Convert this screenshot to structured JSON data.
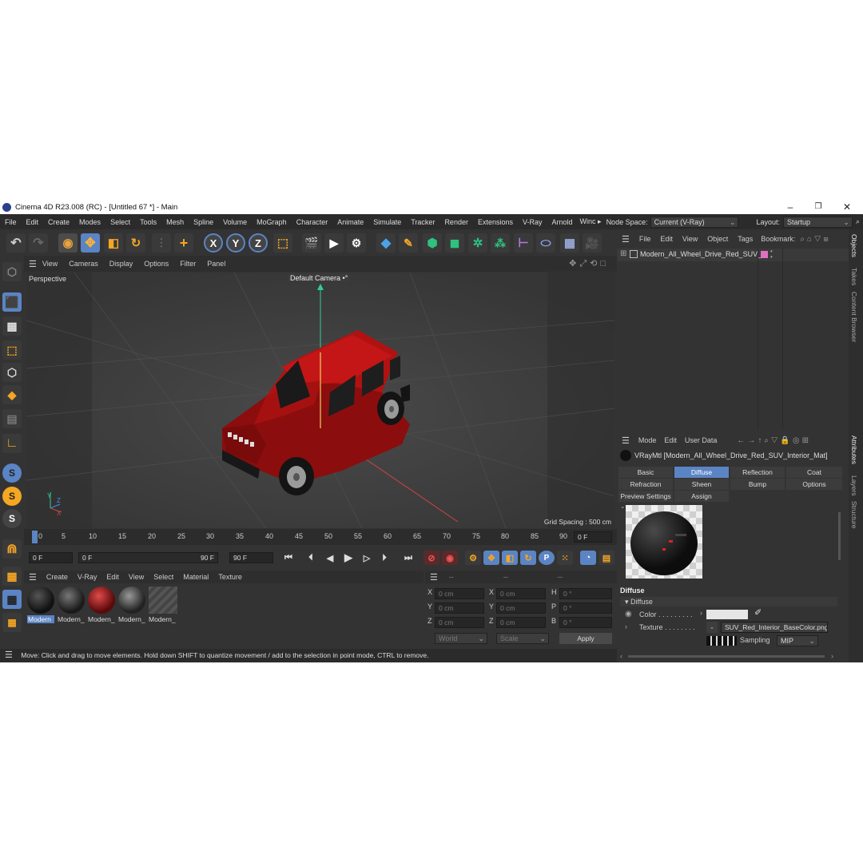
{
  "window": {
    "title": "Cinema 4D R23.008 (RC) - [Untitled 67 *] - Main",
    "minimize": "–",
    "maximize": "❐",
    "close": "✕"
  },
  "menu": {
    "items": [
      "File",
      "Edit",
      "Create",
      "Modes",
      "Select",
      "Tools",
      "Mesh",
      "Spline",
      "Volume",
      "MoGraph",
      "Character",
      "Animate",
      "Simulate",
      "Tracker",
      "Render",
      "Extensions",
      "V-Ray",
      "Arnold",
      "Winc ▸"
    ],
    "node_space_label": "Node Space:",
    "node_space_value": "Current (V-Ray)",
    "layout_label": "Layout:",
    "layout_value": "Startup"
  },
  "viewport": {
    "menu": [
      "View",
      "Cameras",
      "Display",
      "Options",
      "Filter",
      "Panel"
    ],
    "projection": "Perspective",
    "camera": "Default Camera",
    "camera_icon": "•°",
    "grid_spacing": "Grid Spacing : 500 cm"
  },
  "timeline": {
    "ticks": [
      "0",
      "5",
      "10",
      "15",
      "20",
      "25",
      "30",
      "35",
      "40",
      "45",
      "50",
      "55",
      "60",
      "65",
      "70",
      "75",
      "80",
      "85",
      "90"
    ],
    "current_frame": "0 F"
  },
  "playback": {
    "start": "0 F",
    "range_start": "0 F",
    "range_end": "90 F",
    "end": "90 F"
  },
  "materials": {
    "menu": [
      "Create",
      "V-Ray",
      "Edit",
      "View",
      "Select",
      "Material",
      "Texture"
    ],
    "items": [
      "Modern",
      "Modern_",
      "Modern_",
      "Modern_",
      "Modern_"
    ]
  },
  "coords": {
    "header": [
      "--",
      "--",
      "--"
    ],
    "rows": [
      {
        "a": "X",
        "av": "0 cm",
        "b": "X",
        "bv": "0 cm",
        "c": "H",
        "cv": "0 °"
      },
      {
        "a": "Y",
        "av": "0 cm",
        "b": "Y",
        "bv": "0 cm",
        "c": "P",
        "cv": "0 °"
      },
      {
        "a": "Z",
        "av": "0 cm",
        "b": "Z",
        "bv": "0 cm",
        "c": "B",
        "cv": "0 °"
      }
    ],
    "mode1": "World",
    "mode2": "Scale",
    "apply": "Apply"
  },
  "objects": {
    "menu": [
      "File",
      "Edit",
      "View",
      "Object",
      "Tags",
      "Bookmark:"
    ],
    "item": "Modern_All_Wheel_Drive_Red_SUV_g"
  },
  "attributes": {
    "menu": [
      "Mode",
      "Edit",
      "User Data"
    ],
    "material_name": "VRayMtl [Modern_All_Wheel_Drive_Red_SUV_Interior_Mat]",
    "tabs_row1": [
      "Basic",
      "Diffuse",
      "Reflection",
      "Coat"
    ],
    "tabs_row2": [
      "Refraction",
      "Sheen",
      "Bump",
      "Options"
    ],
    "tabs_row3": [
      "Preview Settings",
      "Assign"
    ],
    "section": "Diffuse",
    "subsection": "▾ Diffuse",
    "color_label": "Color . . . . . . . . .",
    "texture_label": "Texture . . . . . . . .",
    "texture_file": "SUV_Red_Interior_BaseColor.png",
    "sampling_label": "Sampling",
    "sampling_value": "MIP",
    "colors": {
      "color_swatch": "#e6e6e6",
      "active_tab": "#5b84c4"
    }
  },
  "right_tabs": [
    "Objects",
    "Takes",
    "Content Browser",
    "Attributes",
    "Layers",
    "Structure"
  ],
  "status": "Move: Click and drag to move elements. Hold down SHIFT to quantize movement / add to the selection in point mode, CTRL to remove."
}
